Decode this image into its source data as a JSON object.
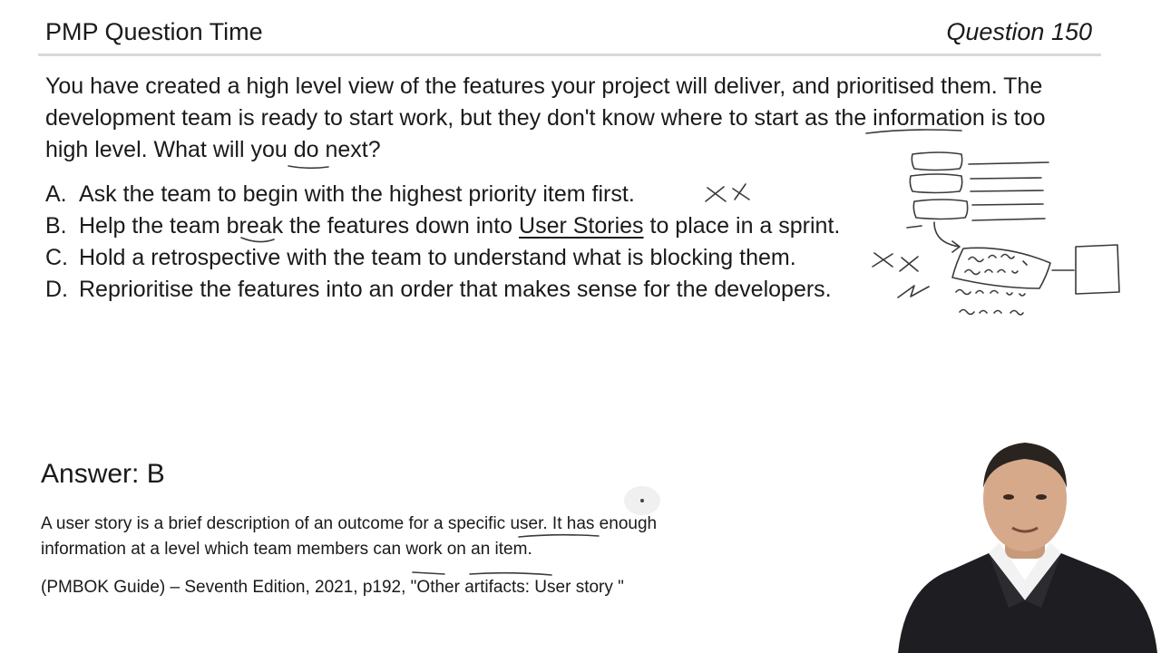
{
  "header": {
    "title": "PMP Question Time",
    "question_number": "Question 150"
  },
  "question": {
    "text": "You have created a high level view of the features your project will deliver, and prioritised them. The development team is ready to start work, but they don't know where to start as the information is too high level. What will you do next?"
  },
  "options": [
    {
      "letter": "A.",
      "text": "Ask the team to begin with the highest priority item first."
    },
    {
      "letter": "B.",
      "text_before": "Help the team break the features down into ",
      "text_link": "User Stories",
      "text_after": " to place in a sprint."
    },
    {
      "letter": "C.",
      "text": "Hold a retrospective with the team to understand what is blocking them."
    },
    {
      "letter": "D.",
      "text": "Reprioritise the features into an order that makes sense for the developers."
    }
  ],
  "answer": {
    "label": "Answer: B",
    "explanation": "A user story is a brief description of an outcome for a specific user. It has enough information at a level which team members can work on an item.",
    "reference": "(PMBOK Guide) – Seventh Edition, 2021, p192, \"Other artifacts: User story \""
  },
  "colors": {
    "ink": "#3a3a3a",
    "rule": "#d9d9d9",
    "suit": "#1e1e22"
  }
}
